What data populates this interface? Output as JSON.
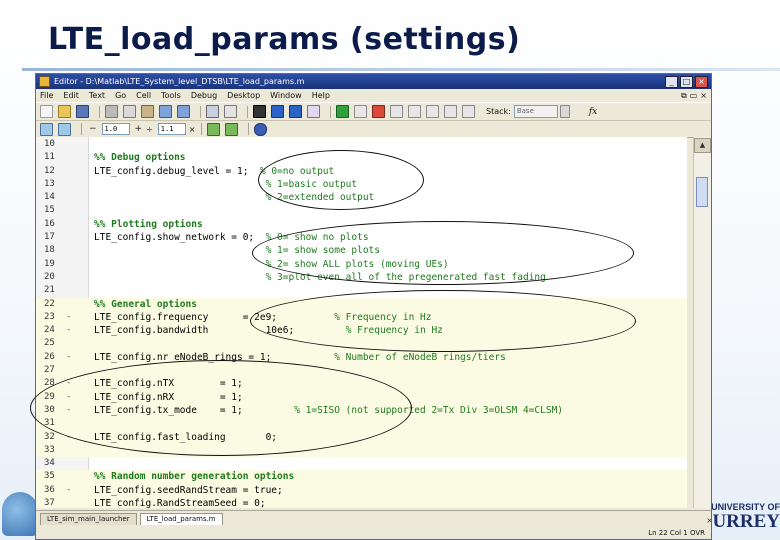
{
  "slide": {
    "title": "LTE_load_params (settings)",
    "logo_right_line1": "UNIVERSITY OF",
    "logo_right_line2": "URREY"
  },
  "window": {
    "title": "Editor - D:\\Matlab\\LTE_System_level_DTSB\\LTE_load_params.m",
    "buttons": [
      "_",
      "□",
      "×"
    ]
  },
  "menubar": {
    "items": [
      "File",
      "Edit",
      "Text",
      "Go",
      "Cell",
      "Tools",
      "Debug",
      "Desktop",
      "Window",
      "Help"
    ],
    "right_controls": [
      "⧉",
      "▭",
      "×"
    ]
  },
  "toolbar": {
    "stack_label": "Stack:",
    "stack_value": "Base",
    "fx_label": "fx"
  },
  "cellbar": {
    "minus_label": "−",
    "field1": "1.0",
    "plus_label": "+",
    "field2": "1.1",
    "times_label": "×"
  },
  "code_lines": [
    {
      "n": "10",
      "m": "",
      "code": "",
      "comment": "",
      "cell": false,
      "style": "normal"
    },
    {
      "n": "11",
      "m": "",
      "code": "%% Debug options",
      "comment": "",
      "cell": false,
      "style": "cellhdr"
    },
    {
      "n": "12",
      "m": "",
      "code": "LTE_config.debug_level = 1;  ",
      "comment": "% 0=no output",
      "cell": false,
      "style": "normal"
    },
    {
      "n": "13",
      "m": "",
      "code": "                              ",
      "comment": "% 1=basic output",
      "cell": false,
      "style": "normal"
    },
    {
      "n": "14",
      "m": "",
      "code": "                              ",
      "comment": "% 2=extended output",
      "cell": false,
      "style": "normal"
    },
    {
      "n": "15",
      "m": "",
      "code": "",
      "comment": "",
      "cell": false,
      "style": "normal"
    },
    {
      "n": "16",
      "m": "",
      "code": "%% Plotting options",
      "comment": "",
      "cell": false,
      "style": "cellhdr"
    },
    {
      "n": "17",
      "m": "",
      "code": "LTE_config.show_network = 0;  ",
      "comment": "% 0= show no plots",
      "cell": false,
      "style": "normal"
    },
    {
      "n": "18",
      "m": "",
      "code": "                              ",
      "comment": "% 1= show some plots",
      "cell": false,
      "style": "normal"
    },
    {
      "n": "19",
      "m": "",
      "code": "                              ",
      "comment": "% 2= show ALL plots (moving UEs)",
      "cell": false,
      "style": "normal"
    },
    {
      "n": "20",
      "m": "",
      "code": "                              ",
      "comment": "% 3=plot even all of the pregenerated fast fading",
      "cell": false,
      "style": "normal"
    },
    {
      "n": "21",
      "m": "",
      "code": "",
      "comment": "",
      "cell": false,
      "style": "normal"
    },
    {
      "n": "22",
      "m": "",
      "code": "%% General options",
      "comment": "",
      "cell": true,
      "style": "cellhdr"
    },
    {
      "n": "23",
      "m": "-",
      "code": "LTE_config.frequency      = 2e9;          ",
      "comment": "% Frequency in Hz",
      "cell": true,
      "style": "normal"
    },
    {
      "n": "24",
      "m": "-",
      "code": "LTE_config.bandwidth          10e6;         ",
      "comment": "% Frequency in Hz",
      "cell": true,
      "style": "normal"
    },
    {
      "n": "25",
      "m": "",
      "code": "",
      "comment": "",
      "cell": true,
      "style": "normal"
    },
    {
      "n": "26",
      "m": "-",
      "code": "LTE_config.nr_eNodeB_rings = 1;           ",
      "comment": "% Number of eNodeB rings/tiers",
      "cell": true,
      "style": "normal"
    },
    {
      "n": "27",
      "m": "",
      "code": "",
      "comment": "",
      "cell": true,
      "style": "normal"
    },
    {
      "n": "28",
      "m": "-",
      "code": "LTE_config.nTX        = 1;",
      "comment": "",
      "cell": true,
      "style": "normal"
    },
    {
      "n": "29",
      "m": "-",
      "code": "LTE_config.nRX        = 1;",
      "comment": "",
      "cell": true,
      "style": "normal"
    },
    {
      "n": "30",
      "m": "-",
      "code": "LTE_config.tx_mode    = 1;         ",
      "comment": "% 1=SISO (not supported 2=Tx Div 3=OLSM 4=CLSM)",
      "cell": true,
      "style": "normal"
    },
    {
      "n": "31",
      "m": "",
      "code": "",
      "comment": "",
      "cell": true,
      "style": "normal"
    },
    {
      "n": "32",
      "m": "-",
      "code": "LTE_config.fast_loading       0;",
      "comment": "",
      "cell": true,
      "style": "normal"
    },
    {
      "n": "33",
      "m": "",
      "code": "",
      "comment": "",
      "cell": true,
      "style": "normal"
    },
    {
      "n": "34",
      "m": "",
      "code": "",
      "comment": "",
      "cell": false,
      "style": "normal"
    },
    {
      "n": "35",
      "m": "",
      "code": "%% Random number generation options",
      "comment": "",
      "cell": true,
      "style": "cellhdr"
    },
    {
      "n": "36",
      "m": "-",
      "code": "LTE_config.seedRandStream = true;",
      "comment": "",
      "cell": true,
      "style": "normal"
    },
    {
      "n": "37",
      "m": "",
      "code": "LTE_config.RandStreamSeed = 0;",
      "comment": "",
      "cell": true,
      "style": "normal"
    }
  ],
  "tabs": [
    {
      "label": "LTE_sim_main_launcher",
      "active": false
    },
    {
      "label": "LTE_load_params.m",
      "active": true
    }
  ],
  "tabs_close": "×",
  "statusbar": {
    "position": "Ln  22    Col  1    OVR"
  }
}
